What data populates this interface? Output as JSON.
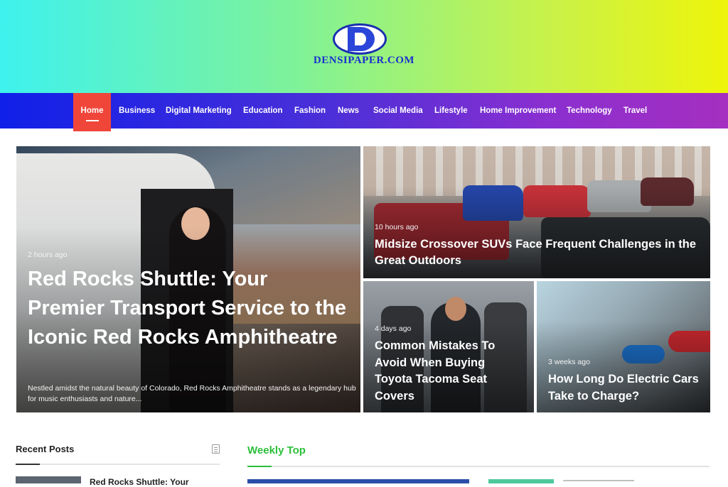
{
  "site": {
    "logo_text": "DENSIPAPER.COM"
  },
  "nav": {
    "items": [
      {
        "label": "Home",
        "active": true
      },
      {
        "label": "Business"
      },
      {
        "label": "Digital Marketing"
      },
      {
        "label": "Education"
      },
      {
        "label": "Fashion"
      },
      {
        "label": "News"
      },
      {
        "label": "Social Media"
      },
      {
        "label": "Lifestyle"
      },
      {
        "label": "Home Improvement"
      },
      {
        "label": "Technology"
      },
      {
        "label": "Travel"
      }
    ],
    "active_color": "#f0463a"
  },
  "featured": {
    "main": {
      "time": "2 hours ago",
      "title": "Red Rocks Shuttle: Your Premier Transport Service to the Iconic Red Rocks Amphitheatre",
      "excerpt": "Nestled amidst the natural beauty of Colorado, Red Rocks Amphitheatre stands as a legendary hub for music enthusiasts and nature..."
    },
    "top_right": {
      "time": "10 hours ago",
      "title": "Midsize Crossover SUVs Face Frequent Challenges in the Great Outdoors"
    },
    "bottom_mid": {
      "time": "4 days ago",
      "title": "Common Mistakes To Avoid When Buying Toyota Tacoma Seat Covers"
    },
    "bottom_right": {
      "time": "3 weeks ago",
      "title": "How Long Do Electric Cars Take to Charge?"
    }
  },
  "recent_posts": {
    "heading": "Recent Posts",
    "first_post_title": "Red Rocks Shuttle: Your"
  },
  "weekly_top": {
    "heading": "Weekly Top",
    "accent": "#2bbf3a"
  }
}
